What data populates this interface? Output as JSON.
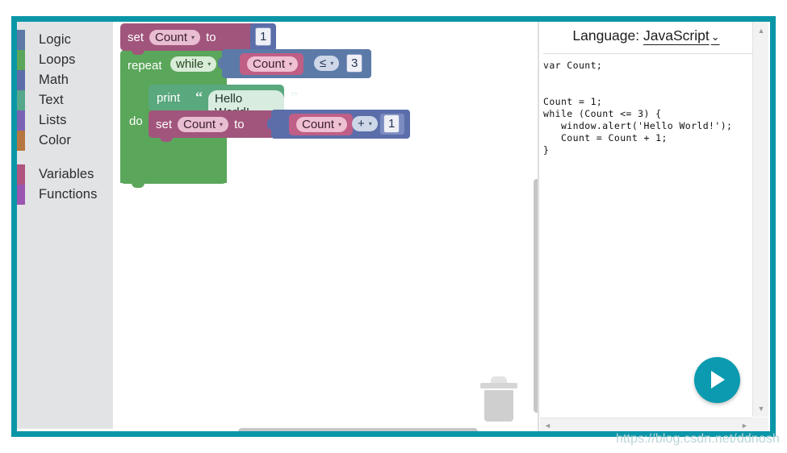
{
  "theme": {
    "frame_border": "#0b96a8",
    "accent": "#0b9ab0",
    "toolbox_bg": "#e2e3e5"
  },
  "toolbox": {
    "categories": [
      {
        "label": "Logic",
        "color": "#5b7aa8"
      },
      {
        "label": "Loops",
        "color": "#5aa65a"
      },
      {
        "label": "Math",
        "color": "#5b6eaa"
      },
      {
        "label": "Text",
        "color": "#56a88a"
      },
      {
        "label": "Lists",
        "color": "#7a63b5"
      },
      {
        "label": "Color",
        "color": "#b5773f"
      }
    ],
    "categories2": [
      {
        "label": "Variables",
        "color": "#b05580"
      },
      {
        "label": "Functions",
        "color": "#9a56b0"
      }
    ]
  },
  "workspace": {
    "blocks": {
      "set_count": {
        "keyword": "set",
        "variable": "Count",
        "to": "to",
        "value": "1"
      },
      "repeat": {
        "keyword": "repeat",
        "mode": "while",
        "do_label": "do"
      },
      "condition": {
        "variable": "Count",
        "operator": "≤",
        "value": "3"
      },
      "print": {
        "keyword": "print",
        "quote_open": "“",
        "quote_close": "”",
        "text": "Hello World!"
      },
      "set_count2": {
        "keyword": "set",
        "variable": "Count",
        "to": "to"
      },
      "arithmetic": {
        "variable": "Count",
        "operator": "+",
        "value": "1"
      }
    },
    "trash_icon": "trash-can-icon"
  },
  "code_panel": {
    "language_label": "Language:",
    "language_value": "JavaScript",
    "chevron": "⌄",
    "code": "var Count;\n\n\nCount = 1;\nwhile (Count <= 3) {\n   window.alert('Hello World!');\n   Count = Count + 1;\n}",
    "scroll_up": "▲",
    "scroll_down": "▼",
    "scroll_left": "◄",
    "scroll_right": "►"
  },
  "run_button": {
    "icon": "play-icon"
  },
  "watermark": {
    "text": "https://blog.csdn.net/ddnosh"
  }
}
